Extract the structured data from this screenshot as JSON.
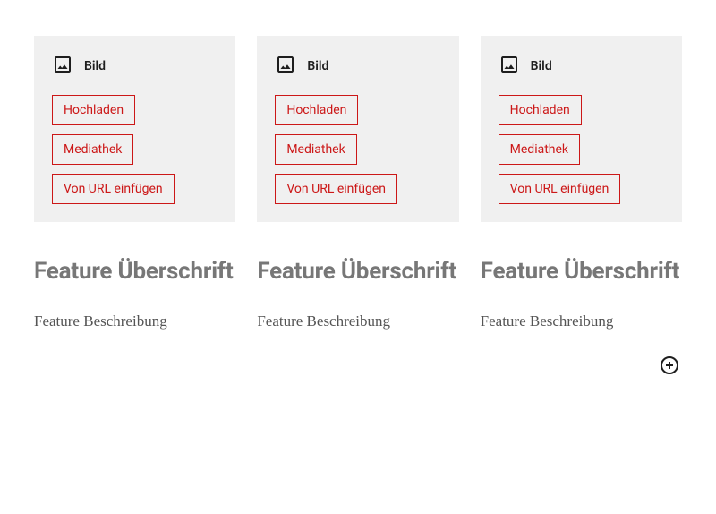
{
  "columns": [
    {
      "image": {
        "label": "Bild",
        "buttons": {
          "upload": "Hochladen",
          "media": "Mediathek",
          "url": "Von URL einfügen"
        }
      },
      "heading": "Feature Überschrift",
      "description": "Feature Beschreibung"
    },
    {
      "image": {
        "label": "Bild",
        "buttons": {
          "upload": "Hochladen",
          "media": "Mediathek",
          "url": "Von URL einfügen"
        }
      },
      "heading": "Feature Überschrift",
      "description": "Feature Beschreibung"
    },
    {
      "image": {
        "label": "Bild",
        "buttons": {
          "upload": "Hochladen",
          "media": "Mediathek",
          "url": "Von URL einfügen"
        }
      },
      "heading": "Feature Überschrift",
      "description": "Feature Beschreibung"
    }
  ]
}
